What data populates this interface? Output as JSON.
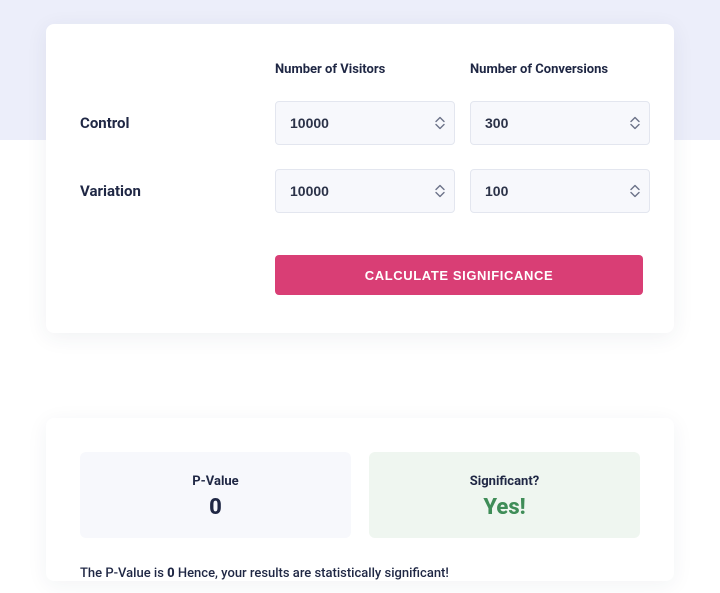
{
  "form": {
    "col_visitors": "Number of Visitors",
    "col_conversions": "Number of Conversions",
    "control_label": "Control",
    "variation_label": "Variation",
    "control_visitors": "10000",
    "control_conversions": "300",
    "variation_visitors": "10000",
    "variation_conversions": "100",
    "button_label": "CALCULATE SIGNIFICANCE"
  },
  "results": {
    "pvalue_title": "P-Value",
    "pvalue_value": "0",
    "sig_title": "Significant?",
    "sig_value": "Yes!",
    "explain_pre": "The P-Value is ",
    "explain_bold": "0",
    "explain_post": " Hence, your results are statistically significant!"
  }
}
